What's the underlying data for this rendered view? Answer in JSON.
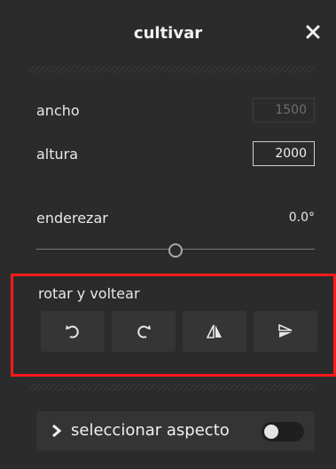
{
  "header": {
    "title": "cultivar",
    "close_icon": "close-icon"
  },
  "dimensions": {
    "width_label": "ancho",
    "width_value": "1500",
    "height_label": "altura",
    "height_value": "2000"
  },
  "straighten": {
    "label": "enderezar",
    "value": "0.0°",
    "slider_fraction": 0.5
  },
  "rotate_flip": {
    "label": "rotar y voltear",
    "buttons": [
      "rotate-left-icon",
      "rotate-right-icon",
      "flip-horizontal-icon",
      "flip-vertical-icon"
    ]
  },
  "aspect": {
    "label": "seleccionar aspecto",
    "toggle_on": false
  },
  "colors": {
    "highlight": "#ff1a1a",
    "background": "#2b2b2b"
  }
}
